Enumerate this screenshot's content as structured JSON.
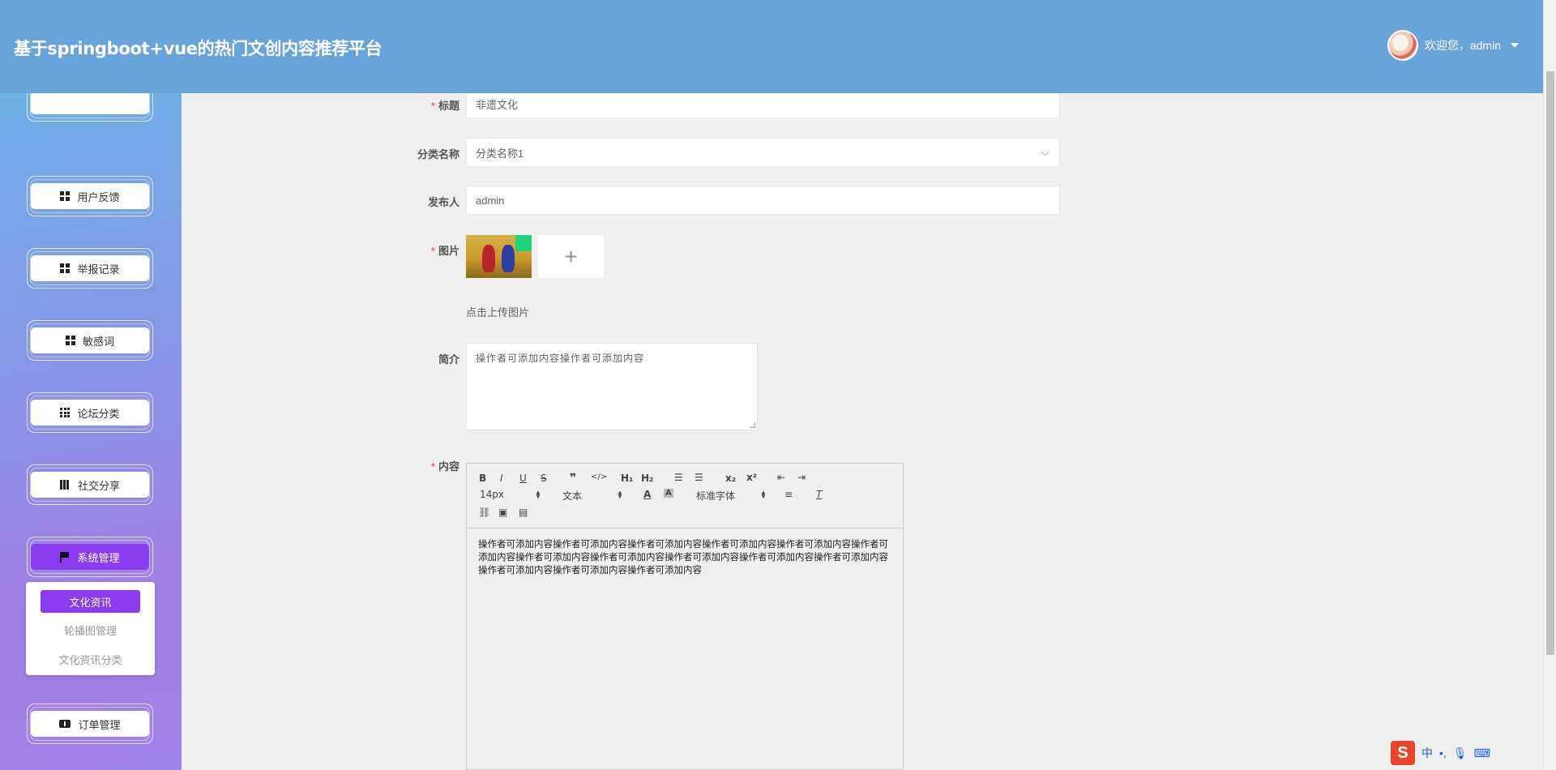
{
  "header": {
    "title": "基于springboot+vue的热门文创内容推荐平台",
    "greeting": "欢迎您，admin"
  },
  "sidebar": {
    "items": [
      {
        "label": "用户反馈",
        "icon": "grid-icon"
      },
      {
        "label": "举报记录",
        "icon": "grid-icon"
      },
      {
        "label": "敏感词",
        "icon": "grid-icon"
      },
      {
        "label": "论坛分类",
        "icon": "grid9-icon"
      },
      {
        "label": "社交分享",
        "icon": "book-icon"
      },
      {
        "label": "系统管理",
        "icon": "flag-icon",
        "active": true
      },
      {
        "label": "订单管理",
        "icon": "ticket-icon"
      }
    ],
    "submenu": {
      "items": [
        "文化资讯",
        "轮播图管理",
        "文化资讯分类"
      ],
      "active": "文化资讯"
    }
  },
  "form": {
    "title_label": "标题",
    "title_value": "非遗文化",
    "category_label": "分类名称",
    "category_value": "分类名称1",
    "publisher_label": "发布人",
    "publisher_value": "admin",
    "image_label": "图片",
    "upload_hint": "点击上传图片",
    "intro_label": "简介",
    "intro_value": "操作者可添加内容操作者可添加内容",
    "content_label": "内容",
    "required_mark": "*"
  },
  "editor": {
    "font_size": "14px",
    "format": "文本",
    "font_family": "标准字体",
    "content": "操作者可添加内容操作者可添加内容操作者可添加内容操作者可添加内容操作者可添加内容操作者可添加内容操作者可添加内容操作者可添加内容操作者可添加内容操作者可添加内容操作者可添加内容操作者可添加内容操作者可添加内容操作者可添加内容"
  },
  "ime": {
    "mode": "中",
    "punct": "•,"
  },
  "colors": {
    "header": "#68a3da",
    "active_purple": "#8b3cf0",
    "required": "#f56c6c"
  }
}
